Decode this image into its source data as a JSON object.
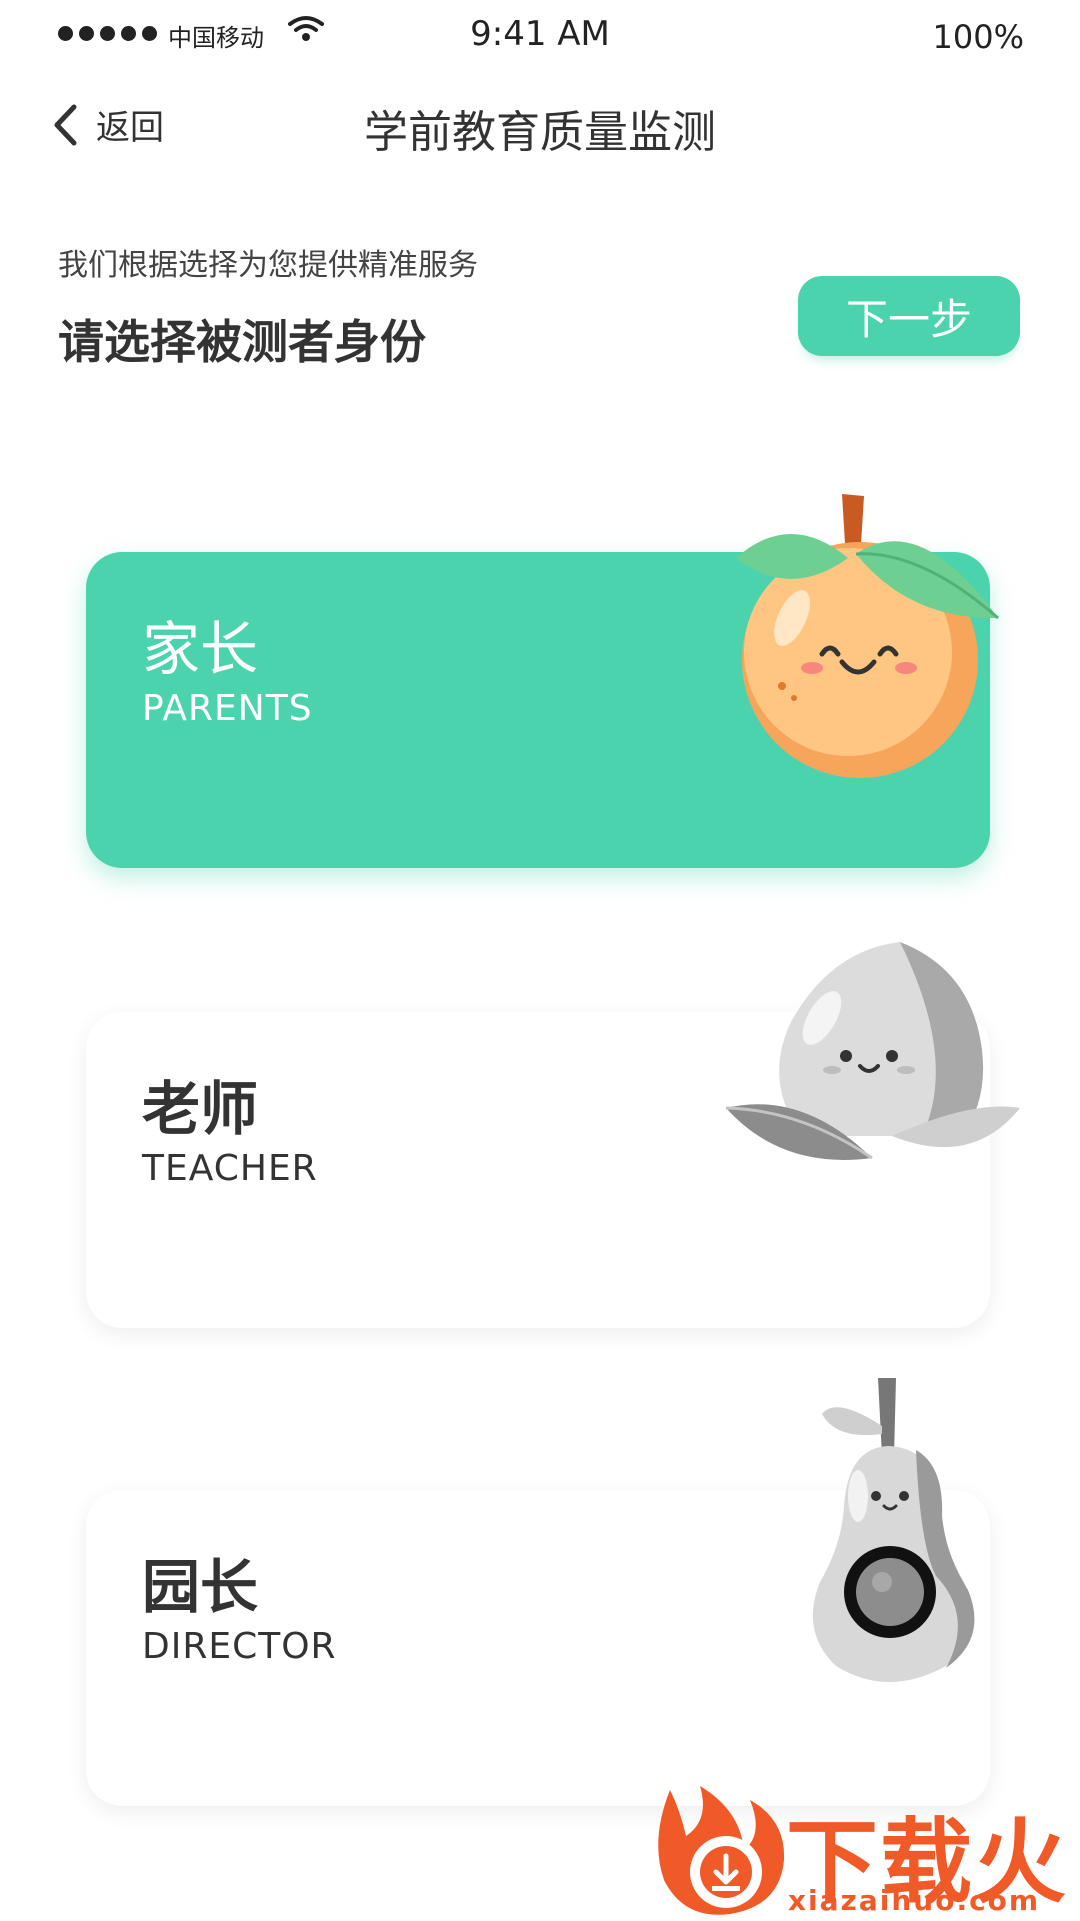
{
  "status_bar": {
    "carrier": "中国移动",
    "time": "9:41 AM",
    "battery": "100%"
  },
  "nav": {
    "back_label": "返回",
    "title": "学前教育质量监测"
  },
  "intro": {
    "subtitle": "我们根据选择为您提供精准服务",
    "heading": "请选择被测者身份",
    "next_label": "下一步"
  },
  "roles": [
    {
      "zh": "家长",
      "en": "PARENTS",
      "selected": true,
      "mascot": "orange-mascot-icon"
    },
    {
      "zh": "老师",
      "en": "TEACHER",
      "selected": false,
      "mascot": "peach-mascot-icon"
    },
    {
      "zh": "园长",
      "en": "DIRECTOR",
      "selected": false,
      "mascot": "pear-mascot-icon"
    }
  ],
  "watermark": {
    "text": "下载火",
    "url": "xiazaihuo.com"
  },
  "colors": {
    "accent": "#4bd3ae",
    "watermark": "#f05a28"
  }
}
